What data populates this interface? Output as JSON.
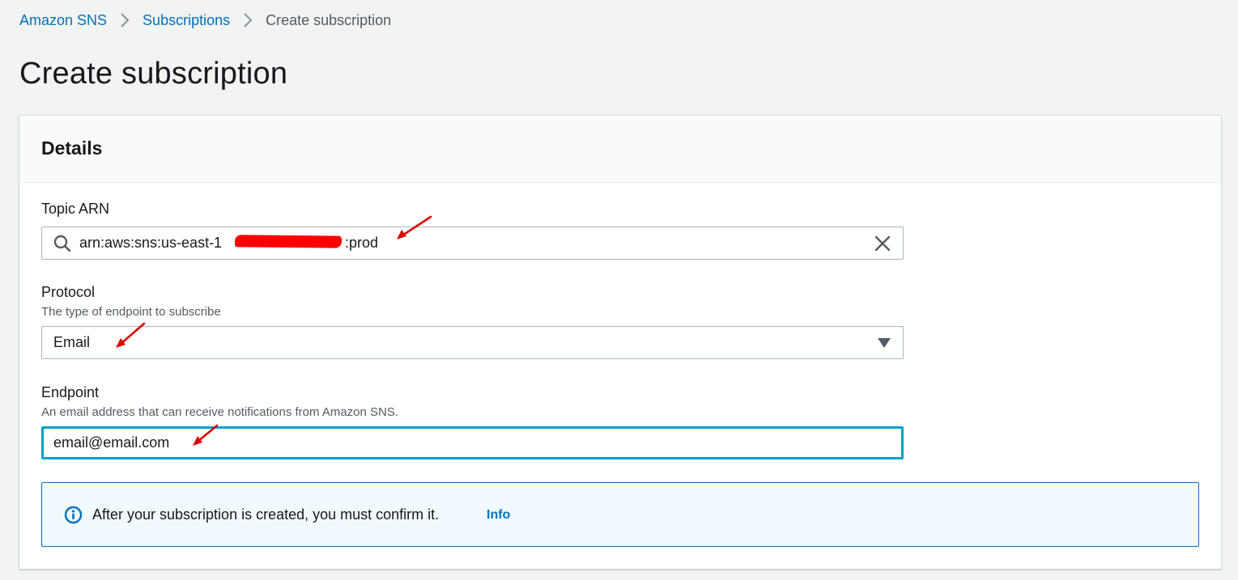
{
  "breadcrumb": {
    "items": [
      {
        "label": "Amazon SNS"
      },
      {
        "label": "Subscriptions"
      },
      {
        "label": "Create subscription"
      }
    ]
  },
  "page_title": "Create subscription",
  "panel": {
    "title": "Details",
    "topic_arn": {
      "label": "Topic ARN",
      "value_prefix": "arn:aws:sns:us-east-1",
      "value_suffix": ":prod"
    },
    "protocol": {
      "label": "Protocol",
      "description": "The type of endpoint to subscribe",
      "selected": "Email"
    },
    "endpoint": {
      "label": "Endpoint",
      "description": "An email address that can receive notifications from Amazon SNS.",
      "value": "email@email.com"
    },
    "alert": {
      "text": "After your subscription is created, you must confirm it.",
      "link": "Info"
    }
  },
  "colors": {
    "link": "#0073bb",
    "focus": "#00a1c9",
    "annotation_arrow": "#e00000"
  }
}
